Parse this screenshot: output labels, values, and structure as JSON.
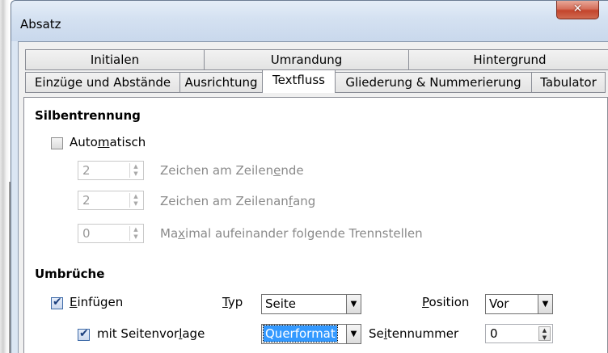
{
  "window": {
    "title": "Absatz",
    "close_glyph": "✕"
  },
  "tabs": {
    "row1": [
      "Initialen",
      "Umrandung",
      "Hintergrund"
    ],
    "row2": [
      "Einzüge und Abstände",
      "Ausrichtung",
      "Textfluss",
      "Gliederung & Nummerierung",
      "Tabulator"
    ],
    "active": "Textfluss"
  },
  "hyphenation": {
    "title": "Silbentrennung",
    "auto": {
      "pre": "Auto",
      "mnemonic": "m",
      "post": "atisch",
      "checked": false
    },
    "rows": [
      {
        "value": "2",
        "pre": "Zeichen am Zeilen",
        "mnemonic": "e",
        "post": "nde"
      },
      {
        "value": "2",
        "pre": "Zeichen am Zeilenan",
        "mnemonic": "f",
        "post": "ang"
      },
      {
        "value": "0",
        "pre": "Ma",
        "mnemonic": "x",
        "post": "imal aufeinander folgende Trennstellen"
      }
    ]
  },
  "breaks": {
    "title": "Umbrüche",
    "insert": {
      "mnemonic": "E",
      "post": "infügen",
      "checked": true
    },
    "type_label": {
      "mnemonic": "T",
      "post": "yp"
    },
    "type_value": "Seite",
    "position_label": {
      "mnemonic": "P",
      "post": "osition"
    },
    "position_value": "Vor",
    "with_style": {
      "pre": "mit Seitenvor",
      "mnemonic": "l",
      "post": "age",
      "checked": true
    },
    "style_value": "Querformat",
    "page_number_label": {
      "pre": "Se",
      "mnemonic": "i",
      "post": "tennummer"
    },
    "page_number_value": "0"
  },
  "icons": {
    "check": "✔",
    "spin_up": "▲",
    "spin_down": "▼",
    "dropdown": "▼"
  }
}
